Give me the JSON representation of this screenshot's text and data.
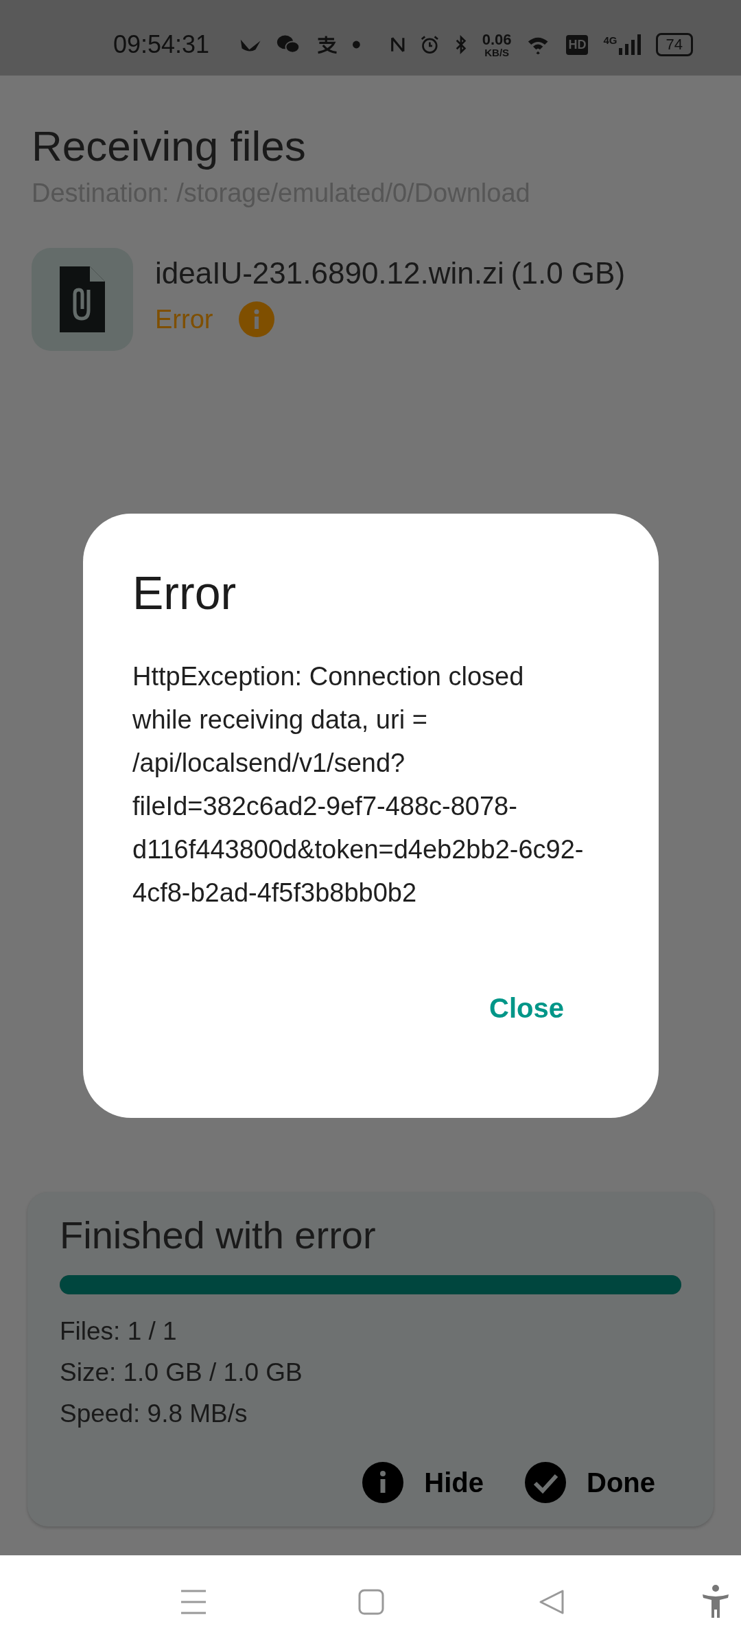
{
  "status_bar": {
    "time": "09:54:31",
    "net_speed": "0.06",
    "net_unit": "KB/S",
    "hd_badge": "HD",
    "network": "4G",
    "battery": "74"
  },
  "header": {
    "title": "Receiving files",
    "destination": "Destination: /storage/emulated/0/Download"
  },
  "files": [
    {
      "name": "ideaIU-231.6890.12.win.zi",
      "size": "(1.0 GB)",
      "status": "Error",
      "kind": "error"
    }
  ],
  "summary": {
    "title": "Finished with error",
    "level": 1,
    "stats": [
      "Files: 1 / 1",
      "Size: 1.0 GB / 1.0 GB",
      "Speed: 9.8 MB/s"
    ],
    "actions": [
      {
        "label": "Hide",
        "kind": "info"
      },
      {
        "label": "Done",
        "kind": "check"
      }
    ]
  },
  "dialog": {
    "title": "Error",
    "message": "HttpException: Connection closed while receiving data, uri = /api/localsend/v1/send?fileId=382c6ad2-9ef7-488c-8078-d116f443800d&token=d4eb2bb2-6c92-4cf8-b2ad-4f5f3b8bb0b2",
    "button": "Close"
  }
}
